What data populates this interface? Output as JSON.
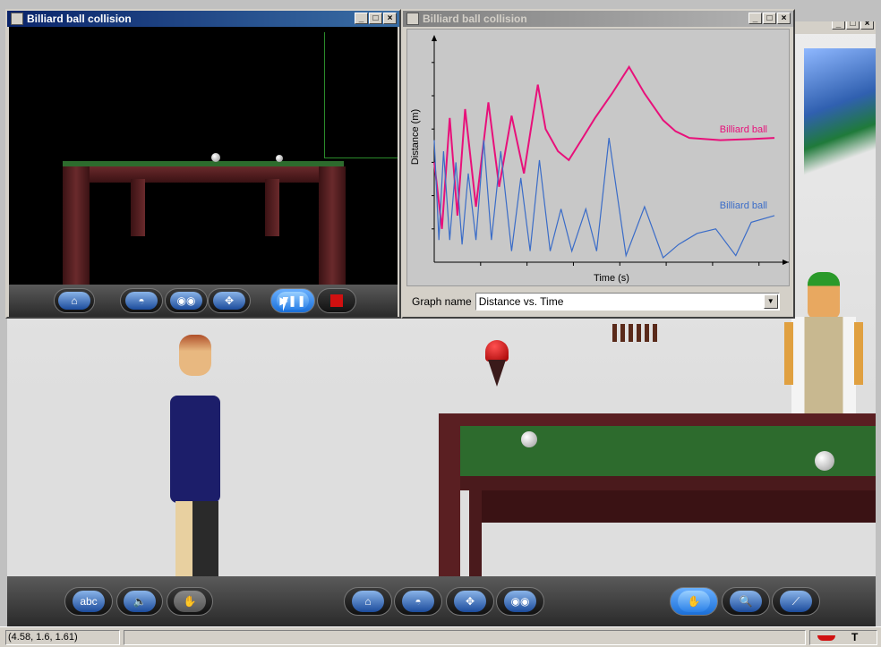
{
  "left_window": {
    "title": "Billiard ball collision",
    "controls": {
      "minimize": "_",
      "maximize": "□",
      "close": "×"
    }
  },
  "right_window": {
    "title": "Billiard ball collision",
    "controls": {
      "minimize": "_",
      "maximize": "□",
      "close": "×"
    },
    "graph_label": "Graph name",
    "graph_select_value": "Distance vs. Time"
  },
  "background_window": {
    "controls": {
      "minimize": "_",
      "maximize": "□",
      "close": "×"
    }
  },
  "chart_data": {
    "type": "line",
    "xlabel": "Time (s)",
    "ylabel": "Distance (m)",
    "grid": false,
    "series": [
      {
        "name": "Billiard ball",
        "color": "#e8107a",
        "x": [
          0,
          0.5,
          1,
          1.5,
          2,
          2.7,
          3.5,
          4.2,
          5,
          5.8,
          6.7,
          7.2,
          8,
          8.7,
          9.6,
          10.4,
          11.5,
          12.6,
          13.6,
          14.8,
          15.6,
          16.5,
          17.5,
          18.5,
          20.5,
          22
        ],
        "y": [
          4.5,
          1.5,
          6.5,
          2.1,
          6.9,
          2.5,
          7.2,
          3.4,
          6.6,
          4.0,
          8.0,
          6.0,
          5.0,
          4.6,
          5.6,
          6.5,
          7.6,
          8.8,
          7.6,
          6.4,
          5.9,
          5.6,
          5.55,
          5.5,
          5.55,
          5.6
        ]
      },
      {
        "name": "Billiard ball",
        "color": "#3a6cc8",
        "x": [
          0,
          0.3,
          0.6,
          1,
          1.4,
          1.8,
          2.2,
          2.7,
          3.2,
          3.7,
          4.3,
          5,
          5.6,
          6.2,
          6.8,
          7.5,
          8.2,
          8.9,
          9.8,
          10.5,
          11.3,
          12.4,
          13.6,
          14.8,
          15.8,
          17,
          18.2,
          19.5,
          20.5,
          22
        ],
        "y": [
          5.5,
          1.0,
          5.0,
          1.0,
          4.5,
          0.8,
          4.0,
          1.0,
          5.5,
          1.0,
          5.0,
          0.5,
          3.8,
          0.5,
          4.6,
          0.5,
          2.4,
          0.5,
          2.4,
          0.5,
          5.6,
          0.3,
          2.5,
          0.2,
          0.8,
          1.3,
          1.5,
          0.3,
          1.8,
          2.1
        ]
      }
    ],
    "legend": [
      "Billiard ball",
      "Billiard ball"
    ]
  },
  "status_bar": {
    "coordinates": "(4.58, 1.6, 1.61)"
  },
  "icons": {
    "home": "home-icon",
    "orbit": "orbit-icon",
    "look": "eyes-icon",
    "move": "move-arrows-icon",
    "play_pause": "play-pause-icon",
    "stop": "stop-icon",
    "speech": "speech-bubble-icon",
    "sound": "speaker-icon",
    "hand": "hand-icon",
    "zoom": "magnifier-icon",
    "graph": "graph-icon"
  },
  "colors": {
    "pink_series": "#e8107a",
    "blue_series": "#3a6cc8",
    "table_felt": "#2d6b2d",
    "table_wood": "#5a1f22",
    "active_button": "#1a6fd8"
  }
}
